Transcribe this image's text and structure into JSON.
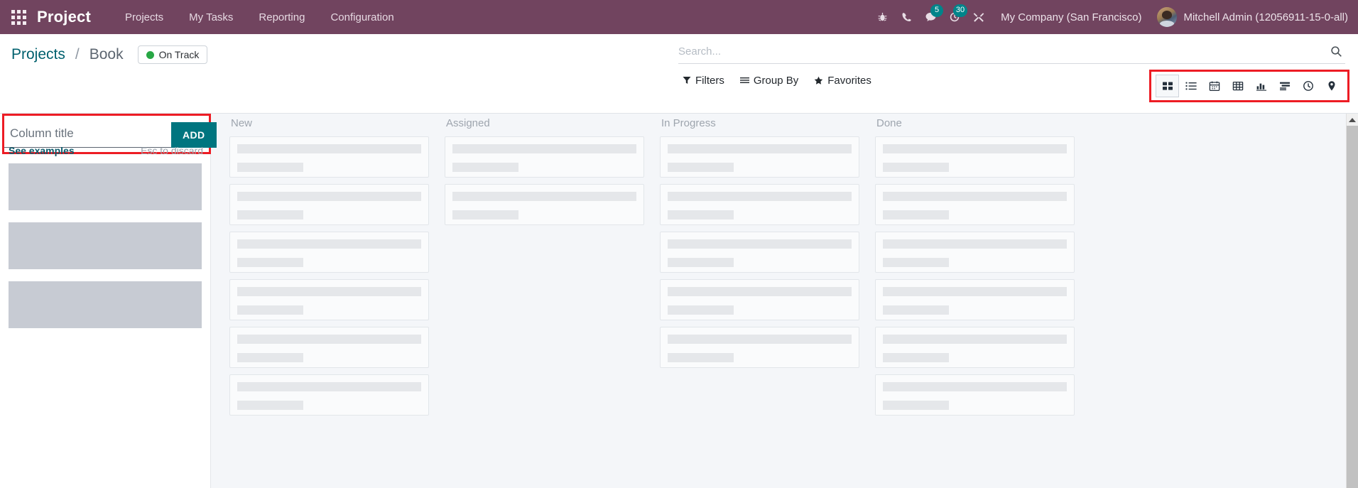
{
  "navbar": {
    "apps_icon": "apps-grid-icon",
    "brand": "Project",
    "menu": [
      {
        "label": "Projects"
      },
      {
        "label": "My Tasks"
      },
      {
        "label": "Reporting"
      },
      {
        "label": "Configuration"
      }
    ],
    "icons": [
      {
        "name": "bug-icon",
        "badge": ""
      },
      {
        "name": "phone-icon",
        "badge": ""
      },
      {
        "name": "messages-icon",
        "badge": "5"
      },
      {
        "name": "activities-clock-icon",
        "badge": "30"
      },
      {
        "name": "tools-wrench-icon",
        "badge": ""
      }
    ],
    "company": "My Company (San Francisco)",
    "user": "Mitchell Admin (12056911-15-0-all)"
  },
  "breadcrumb": {
    "root": "Projects",
    "separator": "/",
    "current": "Book",
    "status_label": "On Track",
    "status_color": "#28a745"
  },
  "search": {
    "placeholder": "Search...",
    "value": "",
    "filters_label": "Filters",
    "group_by_label": "Group By",
    "favorites_label": "Favorites"
  },
  "view_switcher": {
    "highlight_color": "#ed1c24",
    "active": "kanban",
    "views": [
      {
        "key": "kanban",
        "name": "kanban-view-button"
      },
      {
        "key": "list",
        "name": "list-view-button"
      },
      {
        "key": "calendar",
        "name": "calendar-view-button"
      },
      {
        "key": "pivot",
        "name": "pivot-view-button"
      },
      {
        "key": "graph",
        "name": "graph-view-button"
      },
      {
        "key": "gantt",
        "name": "gantt-view-button"
      },
      {
        "key": "activity",
        "name": "activity-view-button"
      },
      {
        "key": "map",
        "name": "map-view-button"
      }
    ]
  },
  "new_column": {
    "highlight_color": "#ed1c24",
    "input_placeholder": "Column title",
    "input_value": "",
    "add_label": "ADD",
    "see_examples_label": "See examples",
    "esc_label": "Esc to discard",
    "ghost_blocks": 3
  },
  "kanban": {
    "columns": [
      {
        "title": "New",
        "card_count": 6
      },
      {
        "title": "Assigned",
        "card_count": 2
      },
      {
        "title": "In Progress",
        "card_count": 5
      },
      {
        "title": "Done",
        "card_count": 6
      }
    ]
  }
}
